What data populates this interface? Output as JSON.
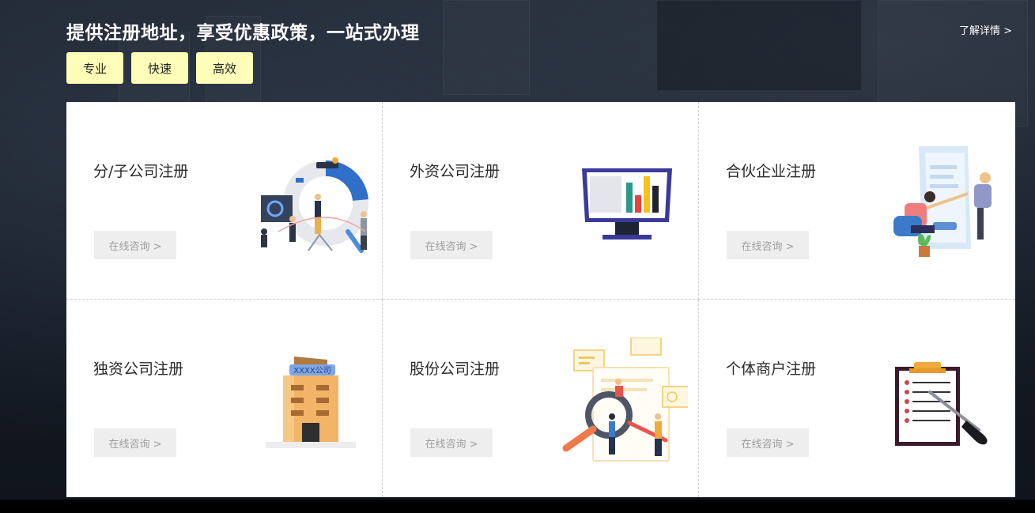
{
  "header": {
    "headline": "提供注册地址，享受优惠政策，一站式办理",
    "more_link": "了解详情 >",
    "tags": [
      "专业",
      "快速",
      "高效"
    ]
  },
  "cards": [
    {
      "title": "分/子公司注册",
      "button": "在线咨询 >",
      "illustration": "team-chart-illustration"
    },
    {
      "title": "外资公司注册",
      "button": "在线咨询 >",
      "illustration": "monitor-chart-illustration"
    },
    {
      "title": "合伙企业注册",
      "button": "在线咨询 >",
      "illustration": "partners-handshake-illustration"
    },
    {
      "title": "独资公司注册",
      "button": "在线咨询 >",
      "illustration": "office-building-illustration",
      "sign": "XXXX公司"
    },
    {
      "title": "股份公司注册",
      "button": "在线咨询 >",
      "illustration": "magnifier-documents-illustration"
    },
    {
      "title": "个体商户注册",
      "button": "在线咨询 >",
      "illustration": "clipboard-pen-illustration"
    }
  ],
  "colors": {
    "tag_bg": "#fffeb8",
    "button_bg": "#eeeeee",
    "button_text": "#9e9e9e",
    "accent_blue": "#2f6fc7",
    "accent_orange": "#f0a93a"
  }
}
